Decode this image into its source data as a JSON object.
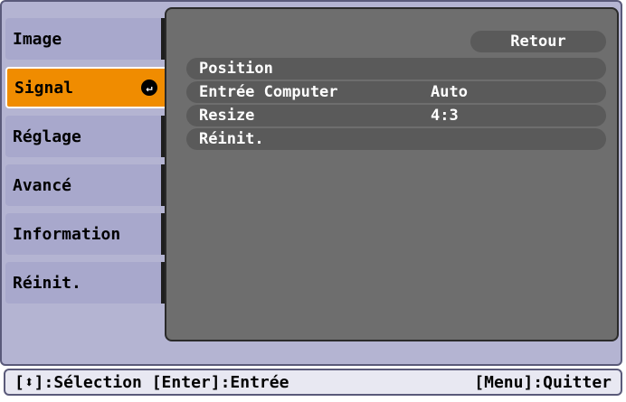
{
  "menu": {
    "items": [
      {
        "label": "Image"
      },
      {
        "label": "Signal"
      },
      {
        "label": "Réglage"
      },
      {
        "label": "Avancé"
      },
      {
        "label": "Information"
      },
      {
        "label": "Réinit."
      }
    ],
    "active_index": 1
  },
  "panel": {
    "back_label": "Retour",
    "rows": [
      {
        "label": "Position",
        "value": ""
      },
      {
        "label": "Entrée Computer",
        "value": "Auto"
      },
      {
        "label": "Resize",
        "value": "4:3"
      },
      {
        "label": "Réinit.",
        "value": ""
      }
    ]
  },
  "status": {
    "left": "[⬍]:Sélection [Enter]:Entrée",
    "right": "[Menu]:Quitter"
  },
  "colors": {
    "background": "#b4b4d2",
    "active_tab": "#f08c00",
    "panel": "#6e6e6e"
  }
}
